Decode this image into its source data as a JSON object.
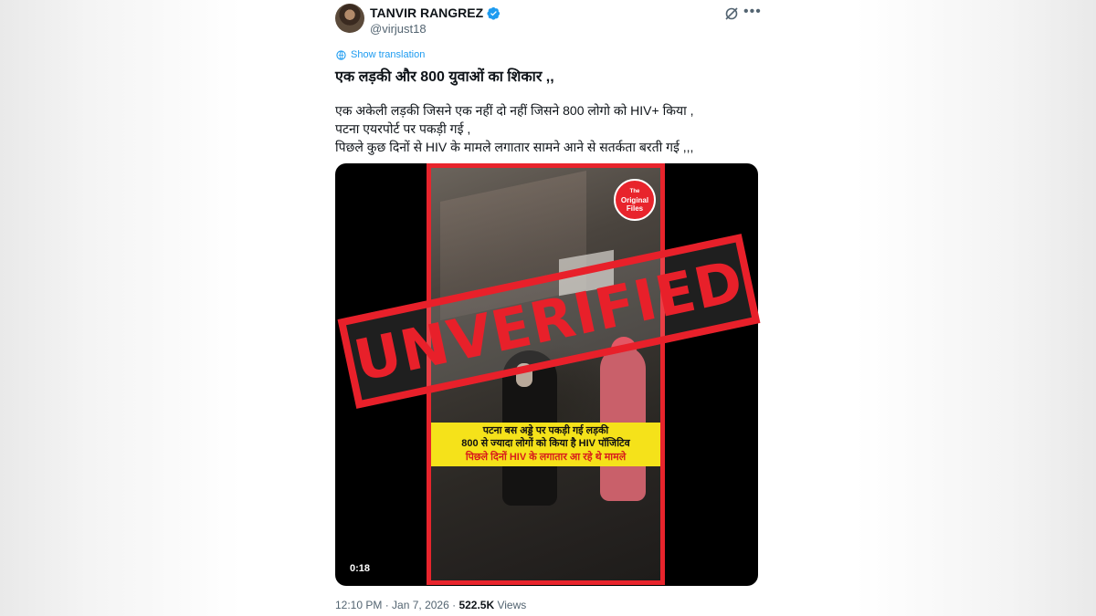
{
  "author": {
    "name": "TANVIR RANGREZ",
    "handle": "@virjust18",
    "verified": true,
    "verified_color": "#1d9bf0"
  },
  "translate_label": "Show translation",
  "headline": "एक लड़की और  800 युवाओं का शिकार ,,",
  "body_lines": [
    "एक अकेली लड़की जिसने एक नहीं दो नहीं जिसने 800 लोगो को HIV+ किया ,",
    "पटना एयरपोर्ट पर पकड़ी गई ,",
    "पिछले कुछ दिनों से HIV के मामले लगातार सामने आने से सतर्कता बरती गई ,,,"
  ],
  "video": {
    "badge": [
      "The",
      "Original",
      "Files"
    ],
    "caption_lines": [
      "पटना बस अड्डे पर पकड़ी गई लड़की",
      "800 से ज्यादा लोगों को किया है HIV पॉजिटिव",
      "पिछले दिनों HIV के लगातार आ रहे थे मामले"
    ],
    "duration": "0:18",
    "frame_color": "#e8242c",
    "caption_bg": "#f5e21a"
  },
  "stamp": {
    "text": "UNVERIFIED",
    "color": "#e8202a"
  },
  "meta": {
    "time": "12:10 PM",
    "separator": " · ",
    "date": "Jan 7, 2026",
    "views_count": "522.5K",
    "views_label": " Views"
  },
  "icons": {
    "grok": "grok-icon",
    "more": "more-icon",
    "translate": "globe-icon",
    "verified": "verified-badge-icon"
  }
}
